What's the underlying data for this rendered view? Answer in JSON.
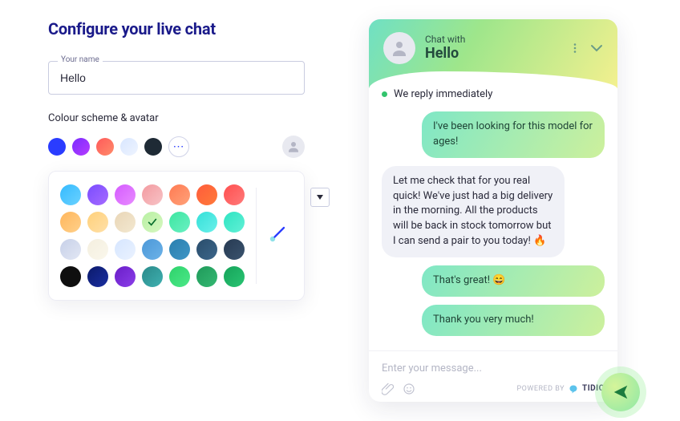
{
  "title": "Configure your live chat",
  "name_field": {
    "label": "Your name",
    "value": "Hello"
  },
  "colour_section_label": "Colour scheme & avatar",
  "quick_colors": [
    "#2a3cff",
    "linear-gradient(135deg,#7a2cff,#b63cff)",
    "linear-gradient(135deg,#ff5a5a,#ff8b6a)",
    "linear-gradient(135deg,#d8e6ff,#eef4ff)",
    "#1e2a35"
  ],
  "more_label": "⋯",
  "palette_selected_index": 10,
  "palette": [
    "linear-gradient(135deg,#35baff,#6ad2ff)",
    "linear-gradient(135deg,#7a4cff,#a66bff)",
    "linear-gradient(135deg,#d45bff,#e88bff)",
    "linear-gradient(135deg,#f39aa0,#f7c3c6)",
    "linear-gradient(135deg,#ff7a52,#ffa27a)",
    "linear-gradient(135deg,#ff5c3b,#ff7a3a)",
    "linear-gradient(135deg,#ff4f4f,#ff7a7a)",
    "linear-gradient(135deg,#ffb65c,#ffd08a)",
    "linear-gradient(135deg,#ffd07a,#ffe0a8)",
    "linear-gradient(135deg,#e9d6b7,#f3e8d0)",
    "linear-gradient(135deg,#b8f0a3,#d6f7c0)",
    "linear-gradient(135deg,#3de6a0,#6af0c3)",
    "linear-gradient(135deg,#34e0d8,#6af0ea)",
    "linear-gradient(135deg,#2ee4c2,#62f0d6)",
    "linear-gradient(135deg,#c7d0e8,#e2e7f4)",
    "linear-gradient(135deg,#f4efdf,#faf7ec)",
    "linear-gradient(135deg,#d6e6ff,#eaf2ff)",
    "linear-gradient(135deg,#4c98d8,#6cb2e8)",
    "linear-gradient(135deg,#2a7fae,#3f96c6)",
    "linear-gradient(135deg,#2a4d6b,#3c668a)",
    "linear-gradient(135deg,#273a52,#3a536e)",
    "#0f0f0f",
    "linear-gradient(135deg,#0b1a6b,#1a2ea0)",
    "linear-gradient(135deg,#6a1ec8,#8b3ee8)",
    "linear-gradient(135deg,#2a8a8a,#3fb0b0)",
    "linear-gradient(135deg,#2ed26b,#4ce888)",
    "linear-gradient(135deg,#1f9a5a,#35b872)",
    "linear-gradient(135deg,#16a35a,#29c472)"
  ],
  "chat": {
    "chat_with_label": "Chat with",
    "name": "Hello",
    "status_text": "We reply immediately",
    "messages": [
      {
        "side": "sent",
        "text": "I've been looking for this model for ages!"
      },
      {
        "side": "received",
        "text": "Let me check that for you real quick! We've just had a big delivery in the morning. All the products will be back in stock tomorrow but I can send a pair to you today! 🔥"
      },
      {
        "side": "sent",
        "text": "That's great! 😄"
      },
      {
        "side": "sent",
        "text": "Thank you very much!"
      }
    ],
    "input_placeholder": "Enter your message...",
    "powered_label": "POWERED BY",
    "brand": "TIDIO"
  }
}
